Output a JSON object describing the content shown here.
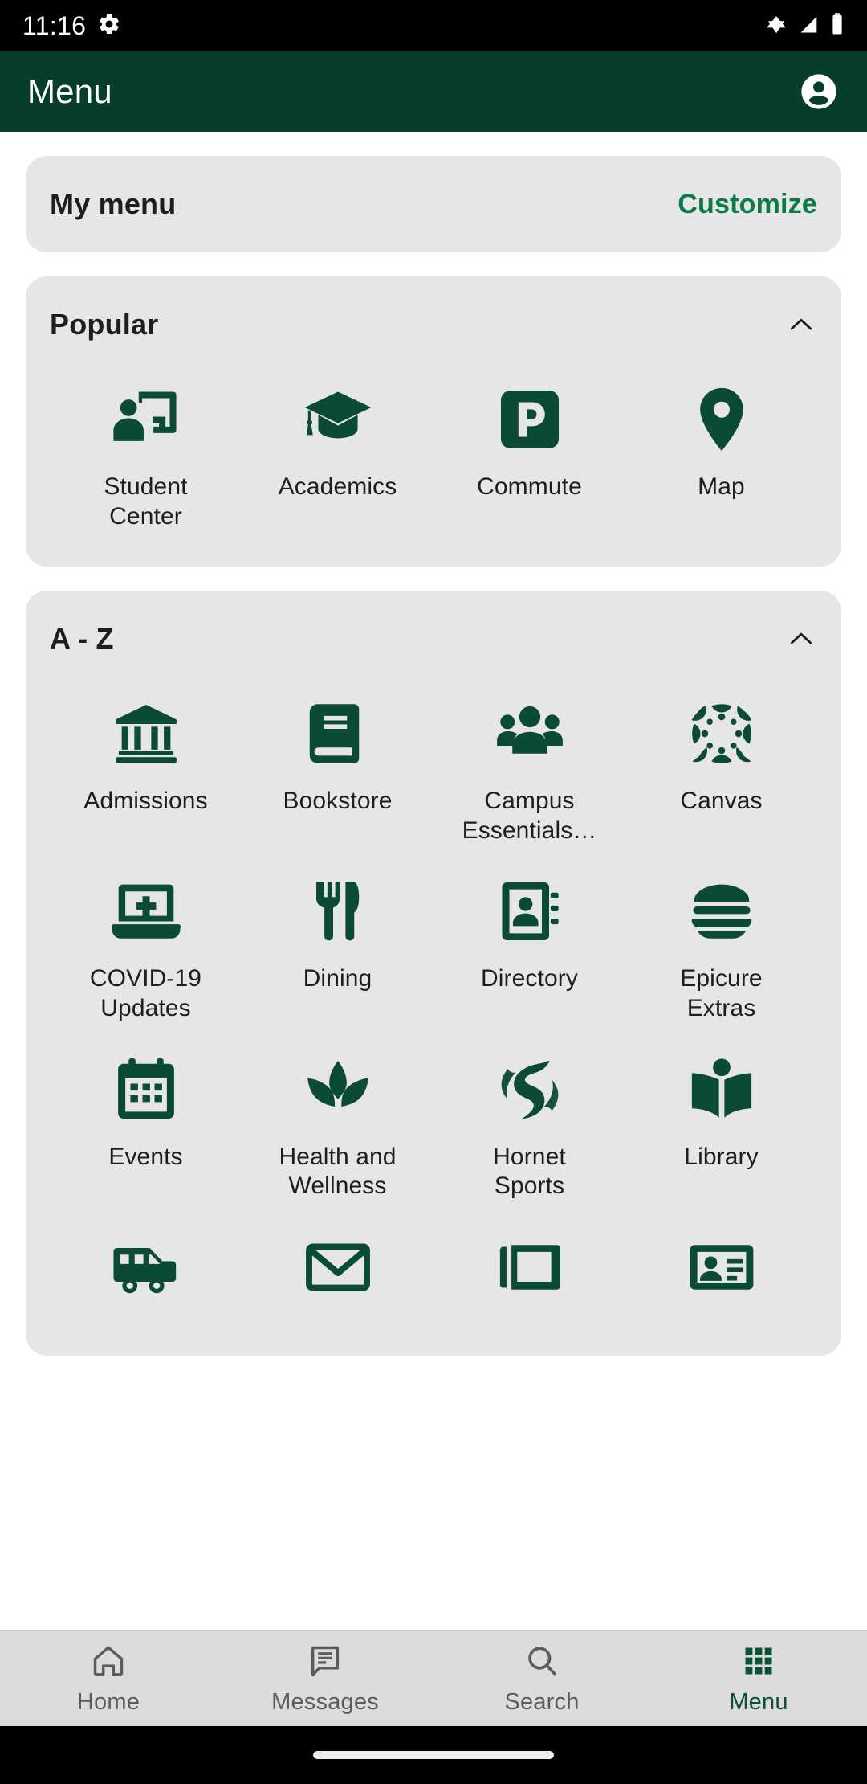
{
  "status_bar": {
    "time": "11:16",
    "icons": [
      "settings-gear-icon",
      "wifi-icon",
      "cellular-signal-icon",
      "battery-icon"
    ]
  },
  "app_bar": {
    "title": "Menu",
    "account_icon": "account-circle-icon"
  },
  "colors": {
    "brand_green": "#063d2c",
    "icon_green": "#0b4a35",
    "link_green": "#0a7a46",
    "card_gray": "#e6e6e6",
    "nav_gray": "#dcdcdc",
    "active_nav": "#0b5134"
  },
  "my_menu_card": {
    "title": "My menu",
    "customize_label": "Customize"
  },
  "popular_card": {
    "title": "Popular",
    "collapse_icon": "chevron-up-icon",
    "expanded": true,
    "items": [
      {
        "label": "Student Center",
        "icon": "student-center-icon"
      },
      {
        "label": "Academics",
        "icon": "graduation-cap-icon"
      },
      {
        "label": "Commute",
        "icon": "parking-p-icon"
      },
      {
        "label": "Map",
        "icon": "map-pin-icon"
      }
    ]
  },
  "az_card": {
    "title": "A - Z",
    "collapse_icon": "chevron-up-icon",
    "expanded": true,
    "items": [
      {
        "label": "Admissions",
        "icon": "bank-columns-icon"
      },
      {
        "label": "Bookstore",
        "icon": "book-icon"
      },
      {
        "label": "Campus Essentials…",
        "icon": "people-group-icon"
      },
      {
        "label": "Canvas",
        "icon": "canvas-logo-icon"
      },
      {
        "label": "COVID-19 Updates",
        "icon": "laptop-medical-icon"
      },
      {
        "label": "Dining",
        "icon": "fork-knife-icon"
      },
      {
        "label": "Directory",
        "icon": "address-book-icon"
      },
      {
        "label": "Epicure Extras",
        "icon": "burger-icon"
      },
      {
        "label": "Events",
        "icon": "calendar-icon"
      },
      {
        "label": "Health and Wellness",
        "icon": "lotus-leaf-icon"
      },
      {
        "label": "Hornet Sports",
        "icon": "sac-state-s-logo-icon"
      },
      {
        "label": "Library",
        "icon": "open-book-icon"
      },
      {
        "label": "",
        "icon": "shuttle-bus-icon"
      },
      {
        "label": "",
        "icon": "envelope-icon"
      },
      {
        "label": "",
        "icon": "newspaper-icon"
      },
      {
        "label": "",
        "icon": "id-card-icon"
      }
    ]
  },
  "bottom_nav": {
    "items": [
      {
        "label": "Home",
        "icon": "home-icon",
        "active": false
      },
      {
        "label": "Messages",
        "icon": "message-icon",
        "active": false
      },
      {
        "label": "Search",
        "icon": "search-icon",
        "active": false
      },
      {
        "label": "Menu",
        "icon": "grid-menu-icon",
        "active": true
      }
    ]
  }
}
